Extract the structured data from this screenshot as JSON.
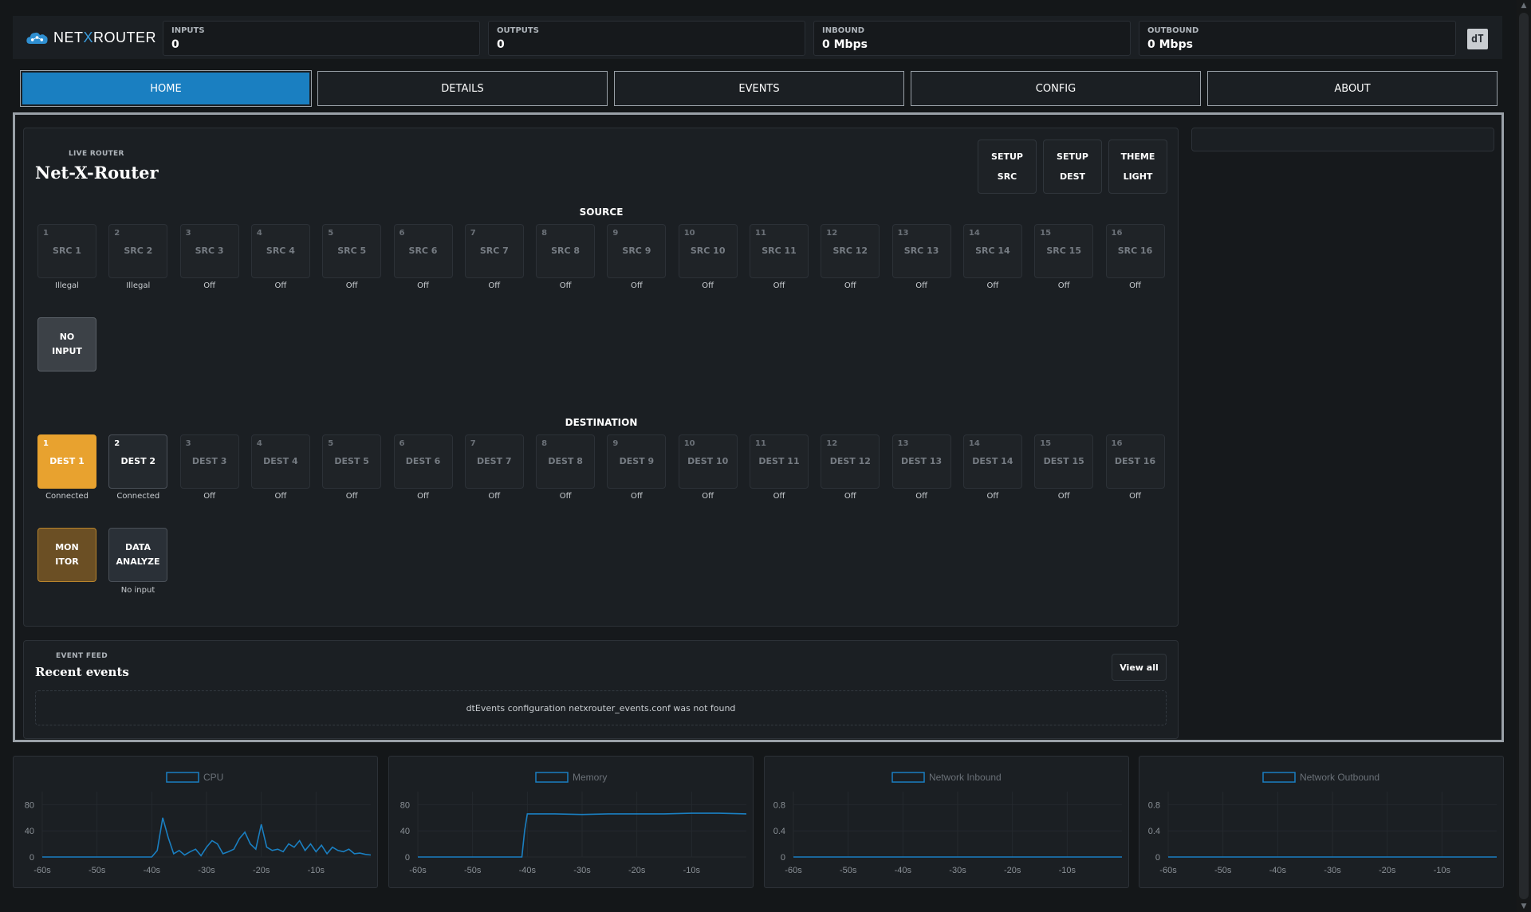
{
  "brand": {
    "name_left": "NET",
    "name_x": "X",
    "name_right": "ROUTER",
    "dt_logo": "dT"
  },
  "stats": [
    {
      "label": "INPUTS",
      "value": "0"
    },
    {
      "label": "OUTPUTS",
      "value": "0"
    },
    {
      "label": "INBOUND",
      "value": "0 Mbps"
    },
    {
      "label": "OUTBOUND",
      "value": "0 Mbps"
    }
  ],
  "tabs": [
    "HOME",
    "DETAILS",
    "EVENTS",
    "CONFIG",
    "ABOUT"
  ],
  "router": {
    "kicker": "LIVE ROUTER",
    "title": "Net-X-Router",
    "buttons": [
      {
        "line1": "SETUP",
        "line2": "SRC"
      },
      {
        "line1": "SETUP",
        "line2": "DEST"
      },
      {
        "line1": "THEME",
        "line2": "LIGHT"
      }
    ],
    "source_title": "SOURCE",
    "sources": [
      {
        "num": "1",
        "name": "SRC 1",
        "status": "Illegal"
      },
      {
        "num": "2",
        "name": "SRC 2",
        "status": "Illegal"
      },
      {
        "num": "3",
        "name": "SRC 3",
        "status": "Off"
      },
      {
        "num": "4",
        "name": "SRC 4",
        "status": "Off"
      },
      {
        "num": "5",
        "name": "SRC 5",
        "status": "Off"
      },
      {
        "num": "6",
        "name": "SRC 6",
        "status": "Off"
      },
      {
        "num": "7",
        "name": "SRC 7",
        "status": "Off"
      },
      {
        "num": "8",
        "name": "SRC 8",
        "status": "Off"
      },
      {
        "num": "9",
        "name": "SRC 9",
        "status": "Off"
      },
      {
        "num": "10",
        "name": "SRC 10",
        "status": "Off"
      },
      {
        "num": "11",
        "name": "SRC 11",
        "status": "Off"
      },
      {
        "num": "12",
        "name": "SRC 12",
        "status": "Off"
      },
      {
        "num": "13",
        "name": "SRC 13",
        "status": "Off"
      },
      {
        "num": "14",
        "name": "SRC 14",
        "status": "Off"
      },
      {
        "num": "15",
        "name": "SRC 15",
        "status": "Off"
      },
      {
        "num": "16",
        "name": "SRC 16",
        "status": "Off"
      }
    ],
    "no_input": {
      "line1": "NO",
      "line2": "INPUT"
    },
    "destination_title": "DESTINATION",
    "destinations": [
      {
        "num": "1",
        "name": "DEST 1",
        "status": "Connected",
        "style": "yellow"
      },
      {
        "num": "2",
        "name": "DEST 2",
        "status": "Connected",
        "style": "bright"
      },
      {
        "num": "3",
        "name": "DEST 3",
        "status": "Off",
        "style": ""
      },
      {
        "num": "4",
        "name": "DEST 4",
        "status": "Off",
        "style": ""
      },
      {
        "num": "5",
        "name": "DEST 5",
        "status": "Off",
        "style": ""
      },
      {
        "num": "6",
        "name": "DEST 6",
        "status": "Off",
        "style": ""
      },
      {
        "num": "7",
        "name": "DEST 7",
        "status": "Off",
        "style": ""
      },
      {
        "num": "8",
        "name": "DEST 8",
        "status": "Off",
        "style": ""
      },
      {
        "num": "9",
        "name": "DEST 9",
        "status": "Off",
        "style": ""
      },
      {
        "num": "10",
        "name": "DEST 10",
        "status": "Off",
        "style": ""
      },
      {
        "num": "11",
        "name": "DEST 11",
        "status": "Off",
        "style": ""
      },
      {
        "num": "12",
        "name": "DEST 12",
        "status": "Off",
        "style": ""
      },
      {
        "num": "13",
        "name": "DEST 13",
        "status": "Off",
        "style": ""
      },
      {
        "num": "14",
        "name": "DEST 14",
        "status": "Off",
        "style": ""
      },
      {
        "num": "15",
        "name": "DEST 15",
        "status": "Off",
        "style": ""
      },
      {
        "num": "16",
        "name": "DEST 16",
        "status": "Off",
        "style": ""
      }
    ],
    "monitor": {
      "line1": "MON",
      "line2": "ITOR"
    },
    "analyze": {
      "line1": "DATA",
      "line2": "ANALYZE",
      "status": "No input"
    }
  },
  "events": {
    "kicker": "EVENT FEED",
    "title": "Recent events",
    "view_all": "View all",
    "message": "dtEvents configuration netxrouter_events.conf was not found"
  },
  "colors": {
    "accent": "#1a7fc1",
    "dest_active": "#e8a22f",
    "monitor": "#6b4f24"
  },
  "chart_data": [
    {
      "type": "line",
      "series": [
        {
          "name": "CPU",
          "x": [
            -60,
            -55,
            -50,
            -45,
            -40,
            -39,
            -38,
            -37,
            -36,
            -35,
            -34,
            -33,
            -32,
            -31,
            -30,
            -29,
            -28,
            -27,
            -26,
            -25,
            -24,
            -23,
            -22,
            -21,
            -20,
            -19,
            -18,
            -17,
            -16,
            -15,
            -14,
            -13,
            -12,
            -11,
            -10,
            -9,
            -8,
            -7,
            -6,
            -5,
            -4,
            -3,
            -2,
            -1,
            0
          ],
          "values": [
            0,
            0,
            0,
            0,
            0,
            10,
            60,
            30,
            5,
            10,
            3,
            8,
            12,
            2,
            15,
            25,
            20,
            5,
            8,
            12,
            28,
            38,
            20,
            12,
            50,
            15,
            10,
            12,
            8,
            20,
            15,
            25,
            10,
            20,
            8,
            18,
            5,
            15,
            10,
            8,
            12,
            5,
            6,
            4,
            3
          ]
        }
      ],
      "x_ticks": [
        "-60s",
        "-50s",
        "-40s",
        "-30s",
        "-20s",
        "-10s"
      ],
      "y_ticks": [
        "0",
        "40",
        "80"
      ],
      "ylim": [
        0,
        100
      ],
      "xlim": [
        -60,
        0
      ]
    },
    {
      "type": "line",
      "series": [
        {
          "name": "Memory",
          "x": [
            -60,
            -50,
            -41,
            -40.5,
            -40,
            -35,
            -30,
            -25,
            -20,
            -15,
            -10,
            -5,
            0
          ],
          "values": [
            0,
            0,
            0,
            40,
            66,
            66,
            65,
            66,
            66,
            66,
            67,
            67,
            66
          ]
        }
      ],
      "x_ticks": [
        "-60s",
        "-50s",
        "-40s",
        "-30s",
        "-20s",
        "-10s"
      ],
      "y_ticks": [
        "0",
        "40",
        "80"
      ],
      "ylim": [
        0,
        100
      ],
      "xlim": [
        -60,
        0
      ]
    },
    {
      "type": "line",
      "series": [
        {
          "name": "Network Inbound",
          "x": [
            -60,
            0
          ],
          "values": [
            0,
            0
          ]
        }
      ],
      "x_ticks": [
        "-60s",
        "-50s",
        "-40s",
        "-30s",
        "-20s",
        "-10s"
      ],
      "y_ticks": [
        "0",
        "0.4",
        "0.8"
      ],
      "ylim": [
        0,
        1
      ],
      "xlim": [
        -60,
        0
      ]
    },
    {
      "type": "line",
      "series": [
        {
          "name": "Network Outbound",
          "x": [
            -60,
            0
          ],
          "values": [
            0,
            0
          ]
        }
      ],
      "x_ticks": [
        "-60s",
        "-50s",
        "-40s",
        "-30s",
        "-20s",
        "-10s"
      ],
      "y_ticks": [
        "0",
        "0.4",
        "0.8"
      ],
      "ylim": [
        0,
        1
      ],
      "xlim": [
        -60,
        0
      ]
    }
  ]
}
